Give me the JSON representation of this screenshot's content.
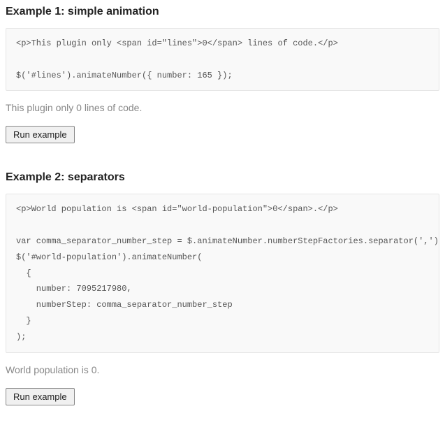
{
  "example1": {
    "heading": "Example 1: simple animation",
    "code": "<p>This plugin only <span id=\"lines\">0</span> lines of code.</p>\n\n$('#lines').animateNumber({ number: 165 });",
    "result": "This plugin only 0 lines of code.",
    "button": "Run example"
  },
  "example2": {
    "heading": "Example 2: separators",
    "code": "<p>World population is <span id=\"world-population\">0</span>.</p>\n\nvar comma_separator_number_step = $.animateNumber.numberStepFactories.separator(',')\n$('#world-population').animateNumber(\n  {\n    number: 7095217980,\n    numberStep: comma_separator_number_step\n  }\n);",
    "result": "World population is 0.",
    "button": "Run example"
  }
}
